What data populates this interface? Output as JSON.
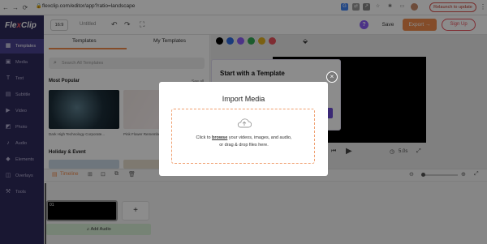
{
  "browser": {
    "url": "flexclip.com/editor/app?ratio=landscape",
    "relaunch_label": "Relaunch to update"
  },
  "app": {
    "logo_prefix": "Fle",
    "logo_x": "x",
    "logo_suffix": "Clip"
  },
  "sidebar": {
    "items": [
      {
        "label": "Templates",
        "icon": "templates-icon",
        "glyph": "▦"
      },
      {
        "label": "Media",
        "icon": "media-icon",
        "glyph": "▣"
      },
      {
        "label": "Text",
        "icon": "text-icon",
        "glyph": "T"
      },
      {
        "label": "Subtitle",
        "icon": "subtitle-icon",
        "glyph": "▤"
      },
      {
        "label": "Video",
        "icon": "video-icon",
        "glyph": "▶"
      },
      {
        "label": "Photo",
        "icon": "photo-icon",
        "glyph": "◩"
      },
      {
        "label": "Audio",
        "icon": "audio-icon",
        "glyph": "♪"
      },
      {
        "label": "Elements",
        "icon": "elements-icon",
        "glyph": "◆"
      },
      {
        "label": "Overlays",
        "icon": "overlays-icon",
        "glyph": "◫"
      },
      {
        "label": "Tools",
        "icon": "tools-icon",
        "glyph": "⚒"
      }
    ]
  },
  "toolbar": {
    "ratio": "16:9",
    "title": "Untitled",
    "save_label": "Save",
    "export_label": "Export →",
    "signup_label": "Sign Up"
  },
  "panel": {
    "tabs": [
      "Templates",
      "My Templates"
    ],
    "search_placeholder": "Search All Templates",
    "section_popular": "Most Popular",
    "see_all": "See all",
    "thumb1_caption": "Dark High Technology Corporate...",
    "thumb2_caption": "Pink Flower Remembe...",
    "section_holiday": "Holiday & Event"
  },
  "stage": {
    "template_card_title": "Start with a Template",
    "duration": "5.0s",
    "swatch_colors": [
      "#000000",
      "#2f6be0",
      "#8a5cf6",
      "#32a852",
      "#e0b020",
      "#e8505b"
    ]
  },
  "timeline": {
    "label": "Timeline",
    "clip_number": "01",
    "add_clip": "+",
    "add_audio": "Add Audio"
  },
  "modal": {
    "title": "Import Media",
    "line1_prefix": "Click to ",
    "line1_link": "browse",
    "line1_suffix": " your videos, images, and audio,",
    "line2": "or drag & drop files here.",
    "close": "×"
  }
}
